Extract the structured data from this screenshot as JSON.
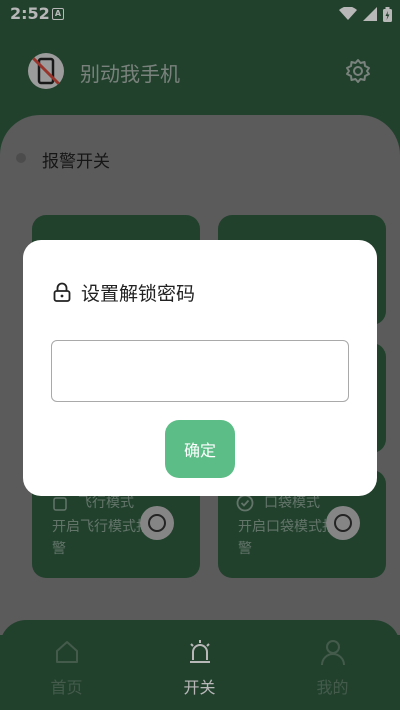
{
  "status_bar": {
    "time": "2:52",
    "app_badge": "A"
  },
  "header": {
    "title": "别动我手机"
  },
  "panel": {
    "alarm_label": "报警开关",
    "cards": [
      {
        "title": "",
        "desc": ""
      },
      {
        "title": "",
        "desc": ""
      },
      {
        "title": "",
        "desc": ""
      },
      {
        "title": "",
        "desc": ""
      },
      {
        "title": "飞行模式",
        "desc": "开启飞行模式报警"
      },
      {
        "title": "口袋模式",
        "desc": "开启口袋模式报警"
      }
    ]
  },
  "bottom_nav": {
    "items": [
      {
        "label": "首页"
      },
      {
        "label": "开关"
      },
      {
        "label": "我的"
      }
    ],
    "active_index": 1
  },
  "dialog": {
    "title": "设置解锁密码",
    "input_value": "",
    "confirm_label": "确定"
  },
  "colors": {
    "primary_green": "#2f5a3f",
    "button_green": "#5dbd87"
  }
}
